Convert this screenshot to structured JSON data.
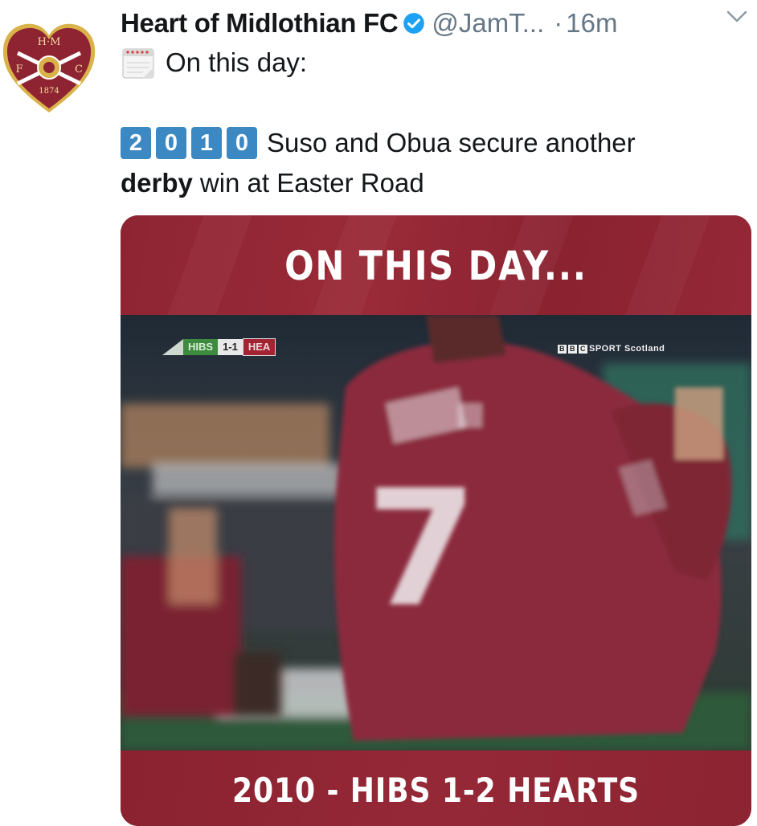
{
  "tweet": {
    "display_name": "Heart of Midlothian FC",
    "handle": "@JamT...",
    "separator": "·",
    "time": "16m",
    "icons": {
      "avatar": "hearts-crest-avatar",
      "verified": "verified-badge-icon",
      "menu": "chevron-down-icon",
      "calendar": "calendar-emoji-icon"
    },
    "line1_text": "On this day:",
    "year_digits": [
      "2",
      "0",
      "1",
      "0"
    ],
    "line2_text": "Suso and Obua secure another",
    "line3_bold": "derby",
    "line3_text": "win at Easter Road",
    "crest": {
      "top_letters": "H·M",
      "left_letter": "F",
      "right_letter": "C",
      "year": "1874"
    }
  },
  "media": {
    "title": "ON THIS DAY...",
    "caption": "2010 - HIBS 1-2 HEARTS",
    "scoreboard": {
      "home": "HIBS",
      "score": "1-1",
      "away": "HEA"
    },
    "broadcaster_letters": [
      "B",
      "B",
      "C"
    ],
    "broadcaster_text": "SPORT Scotland",
    "shirt_number": "7"
  },
  "colors": {
    "accent_blue": "#1da1f2",
    "keycap_blue": "#3b88c3",
    "maroon": "#8b2331",
    "secondary_text": "#657786"
  }
}
